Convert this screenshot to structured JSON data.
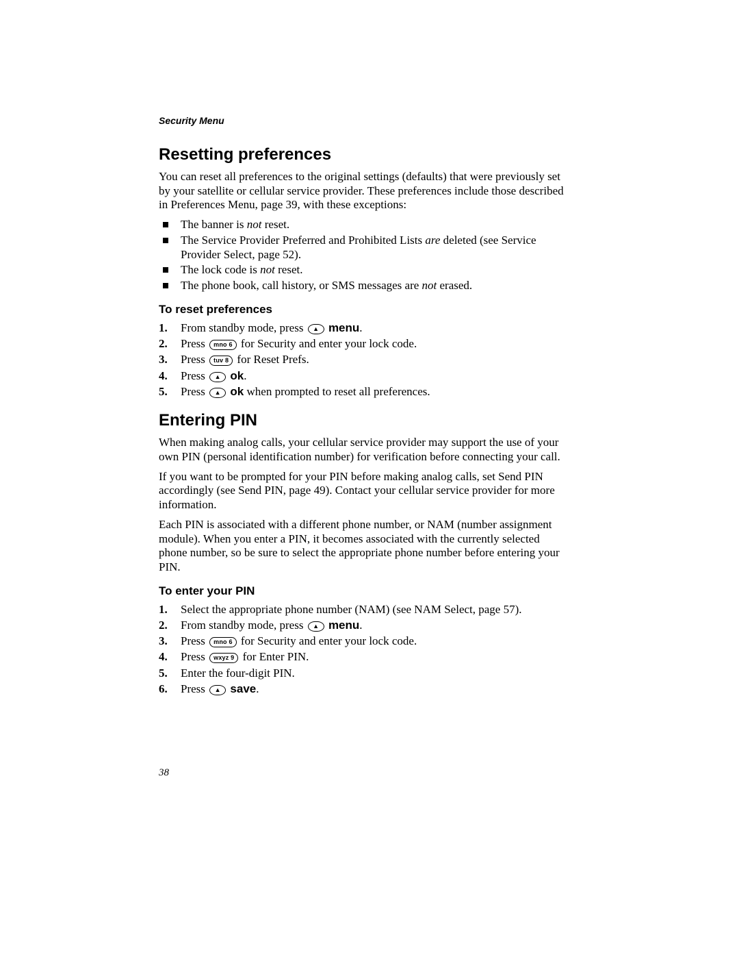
{
  "header": {
    "running": "Security Menu"
  },
  "section1": {
    "title": "Resetting preferences",
    "intro": "You can reset all preferences to the original settings (defaults) that were previously set by your satellite or cellular service provider. These preferences include those described in Preferences Menu, page 39, with these exceptions:",
    "bullets": {
      "b1a": "The banner is ",
      "b1b": "not",
      "b1c": " reset.",
      "b2a": "The Service Provider Preferred and Prohibited Lists ",
      "b2b": "are",
      "b2c": " deleted (see Service Provider Select, page 52).",
      "b3a": "The lock code is ",
      "b3b": "not",
      "b3c": " reset.",
      "b4a": "The phone book, call history, or SMS messages are ",
      "b4b": "not",
      "b4c": " erased."
    },
    "sub": "To reset preferences",
    "steps": {
      "s1a": "From standby mode, press ",
      "s1key": "▲",
      "s1b": " ",
      "s1c": "menu",
      "s1d": ".",
      "s2a": "Press ",
      "s2key": "mno 6",
      "s2b": " for Security and enter your lock code.",
      "s3a": "Press ",
      "s3key": "tuv 8",
      "s3b": " for Reset Prefs.",
      "s4a": "Press ",
      "s4key": "▲",
      "s4b": " ",
      "s4c": "ok",
      "s4d": ".",
      "s5a": "Press ",
      "s5key": "▲",
      "s5b": " ",
      "s5c": "ok",
      "s5d": " when prompted to reset all preferences."
    }
  },
  "section2": {
    "title": "Entering PIN",
    "p1": "When making analog calls, your cellular service provider may support the use of your own PIN (personal identification number) for verification before connecting your call.",
    "p2": "If you want to be prompted for your PIN before making analog calls, set Send PIN accordingly (see Send PIN, page 49). Contact your cellular service provider for more information.",
    "p3": "Each PIN is associated with a different phone number, or NAM (number assignment module). When you enter a PIN, it becomes associated with the currently selected phone number, so be sure to select the appropriate phone number before entering your PIN.",
    "sub": "To enter your PIN",
    "steps": {
      "s1": "Select the appropriate phone number (NAM) (see NAM Select, page 57).",
      "s2a": "From standby mode, press ",
      "s2key": "▲",
      "s2b": " ",
      "s2c": "menu",
      "s2d": ".",
      "s3a": "Press ",
      "s3key": "mno 6",
      "s3b": " for Security and enter your lock code.",
      "s4a": "Press ",
      "s4key": "wxyz 9",
      "s4b": " for Enter PIN.",
      "s5": "Enter the four-digit PIN.",
      "s6a": "Press ",
      "s6key": "▲",
      "s6b": " ",
      "s6c": "save",
      "s6d": "."
    }
  },
  "pageNumber": "38"
}
